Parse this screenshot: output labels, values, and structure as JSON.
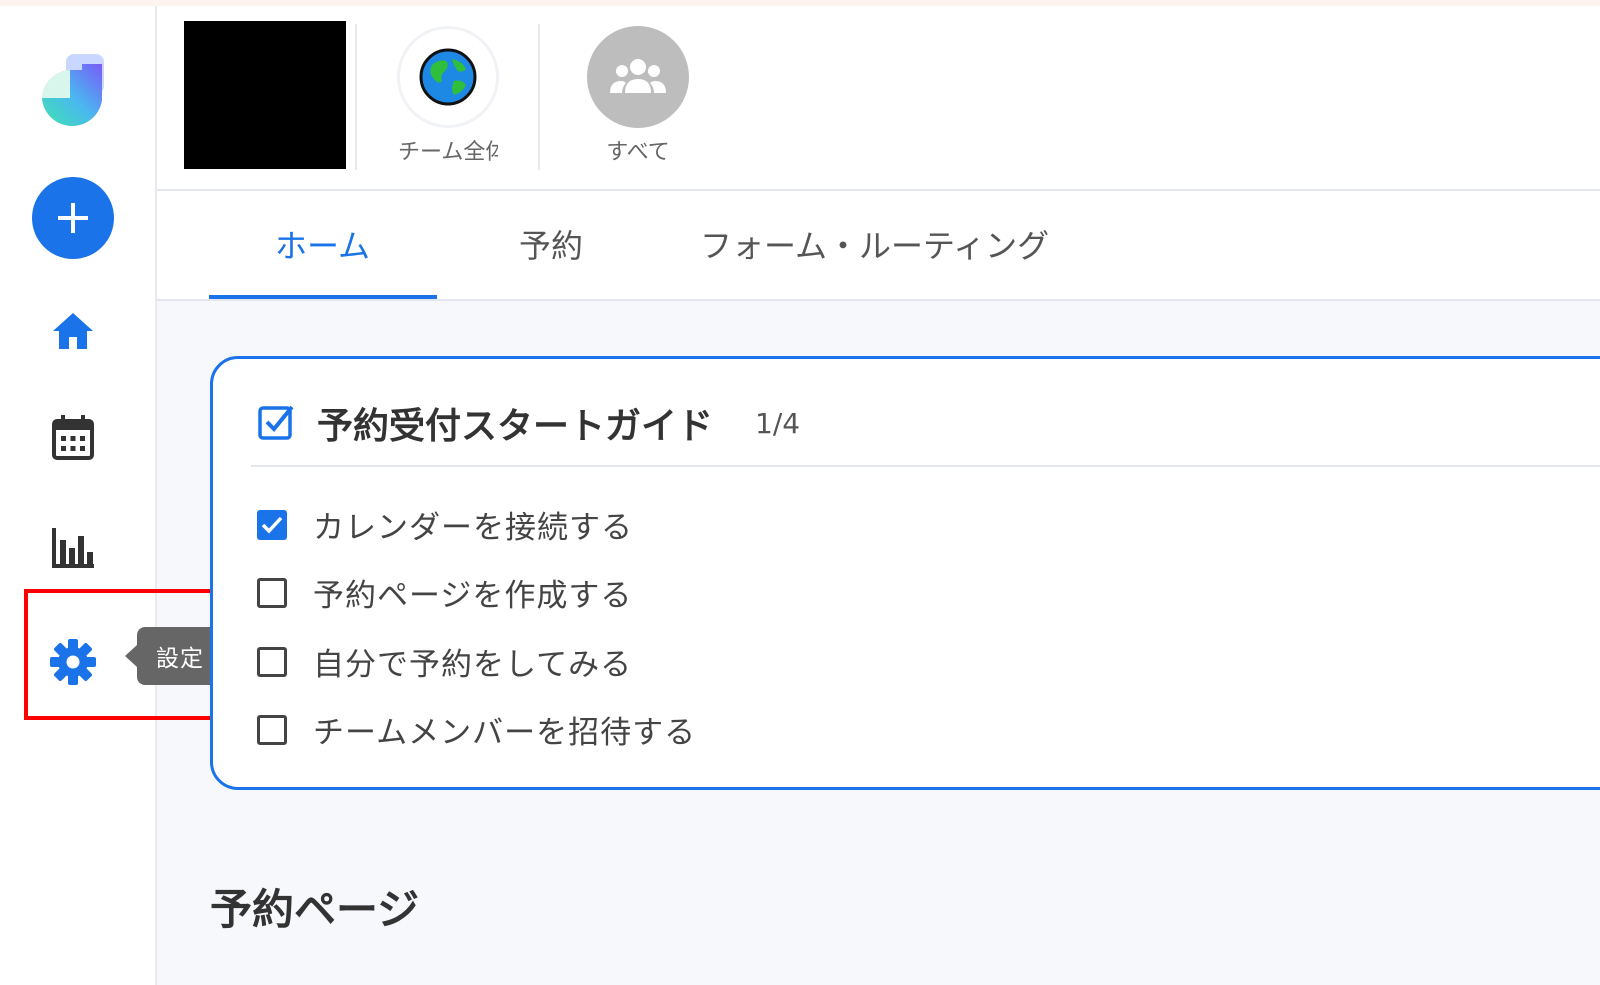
{
  "sidebar": {
    "add_button": {
      "icon": "plus-icon"
    },
    "items": [
      {
        "icon": "home-icon"
      },
      {
        "icon": "calendar-icon"
      },
      {
        "icon": "bar-chart-icon"
      },
      {
        "icon": "gear-icon"
      }
    ],
    "tooltip": "設定"
  },
  "header": {
    "items": [
      {
        "label": "チーム全体",
        "icon": "globe-icon"
      },
      {
        "label": "すべて",
        "icon": "group-icon"
      }
    ]
  },
  "tabs": [
    {
      "label": "ホーム",
      "active": true
    },
    {
      "label": "予約",
      "active": false
    },
    {
      "label": "フォーム・ルーティング",
      "active": false
    }
  ],
  "guide": {
    "title": "予約受付スタートガイド",
    "progress": "1/4",
    "tasks": [
      {
        "label": "カレンダーを接続する",
        "checked": true
      },
      {
        "label": "予約ページを作成する",
        "checked": false
      },
      {
        "label": "自分で予約をしてみる",
        "checked": false
      },
      {
        "label": "チームメンバーを招待する",
        "checked": false
      }
    ]
  },
  "section": {
    "title": "予約ページ"
  },
  "colors": {
    "accent": "#1a73e8",
    "highlight": "#ff0000",
    "tooltip_bg": "#666666"
  }
}
